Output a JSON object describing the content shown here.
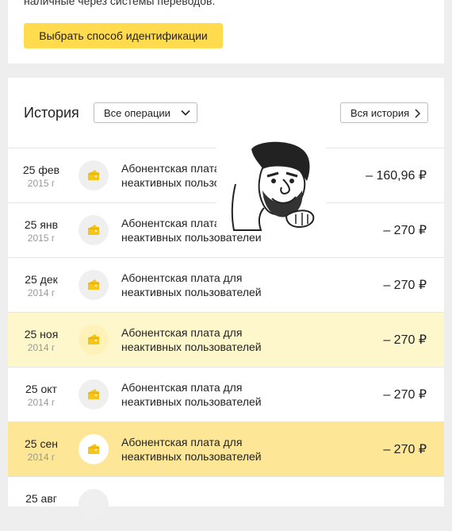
{
  "top": {
    "text": "наличные через системы переводов.",
    "button_label": "Выбрать способ идентификации"
  },
  "history": {
    "title": "История",
    "filter_value": "Все операции",
    "all_history_label": "Вся история"
  },
  "colors": {
    "accent_button": "#ffdb4d",
    "highlight_light": "#fff7cc",
    "highlight_strong": "#fde796"
  },
  "icons": {
    "row_icon": "wallet-icon",
    "filter_chevron": "chevron-down-icon",
    "all_history_chevron": "chevron-right-icon"
  },
  "transactions": [
    {
      "day": "25 фев",
      "year": "2015 г",
      "description_line1": "Абонентская плата для",
      "description_line2": "неактивных пользователей",
      "amount": "– 160,96 ₽"
    },
    {
      "day": "25 янв",
      "year": "2015 г",
      "description_line1": "Абонентская плата для",
      "description_line2": "неактивных пользователей",
      "amount": "– 270 ₽"
    },
    {
      "day": "25 дек",
      "year": "2014 г",
      "description_line1": "Абонентская плата для",
      "description_line2": "неактивных пользователей",
      "amount": "– 270 ₽"
    },
    {
      "day": "25 ноя",
      "year": "2014 г",
      "description_line1": "Абонентская плата для",
      "description_line2": "неактивных пользователей",
      "amount": "– 270 ₽"
    },
    {
      "day": "25 окт",
      "year": "2014 г",
      "description_line1": "Абонентская плата для",
      "description_line2": "неактивных пользователей",
      "amount": "– 270 ₽"
    },
    {
      "day": "25 сен",
      "year": "2014 г",
      "description_line1": "Абонентская плата для",
      "description_line2": "неактивных пользователей",
      "amount": "– 270 ₽"
    },
    {
      "day": "25 авг",
      "year": "",
      "description_line1": "",
      "description_line2": "",
      "amount": ""
    }
  ]
}
